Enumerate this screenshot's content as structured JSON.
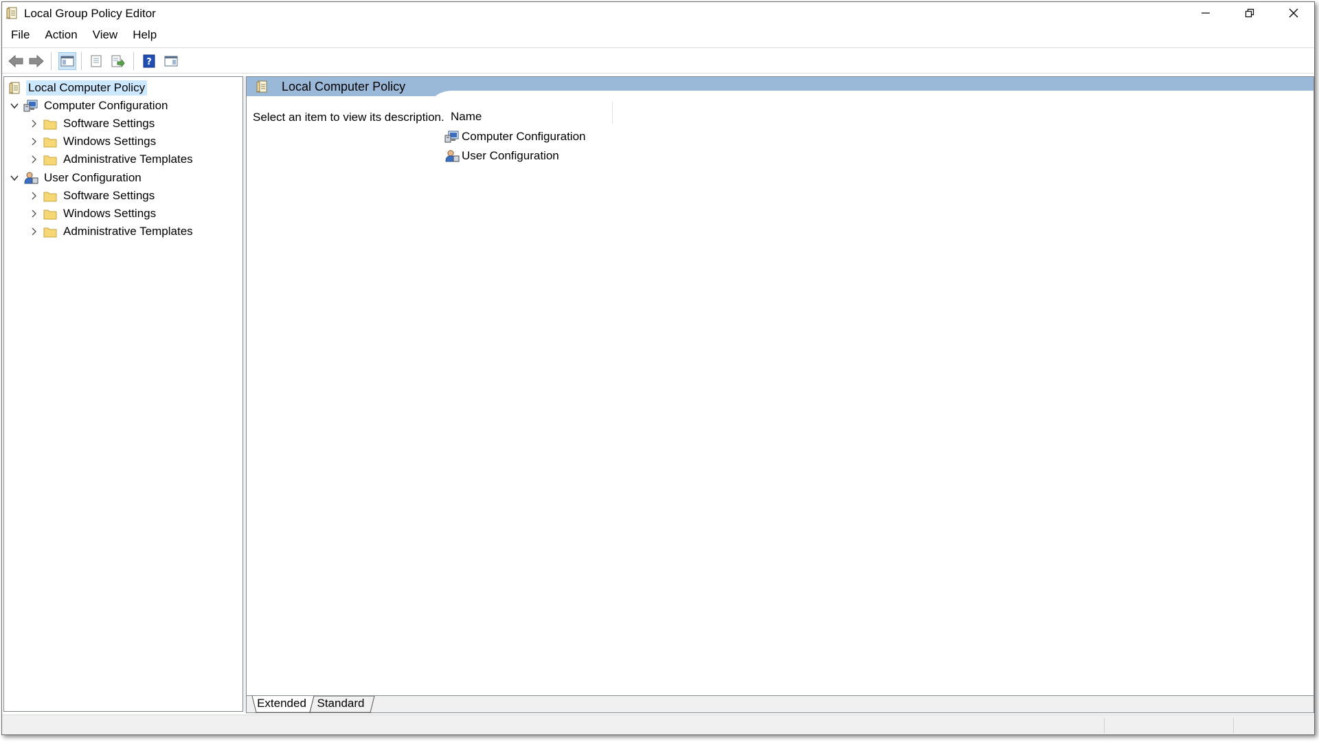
{
  "window": {
    "title": "Local Group Policy Editor",
    "controls": [
      "minimize",
      "restore",
      "close"
    ]
  },
  "menu": {
    "items": [
      "File",
      "Action",
      "View",
      "Help"
    ]
  },
  "toolbar": {
    "buttons": [
      {
        "name": "back",
        "icon": "back-arrow-icon"
      },
      {
        "name": "forward",
        "icon": "forward-arrow-icon"
      },
      {
        "name": "show-hide-console-tree",
        "icon": "console-tree-icon",
        "active": true
      },
      {
        "name": "properties",
        "icon": "properties-icon"
      },
      {
        "name": "export-list",
        "icon": "export-list-icon"
      },
      {
        "name": "help",
        "icon": "help-icon"
      },
      {
        "name": "show-hide-action-pane",
        "icon": "action-pane-icon"
      }
    ]
  },
  "tree": {
    "root": "Local Computer Policy",
    "computer": {
      "label": "Computer Configuration",
      "children": [
        "Software Settings",
        "Windows Settings",
        "Administrative Templates"
      ]
    },
    "user": {
      "label": "User Configuration",
      "children": [
        "Software Settings",
        "Windows Settings",
        "Administrative Templates"
      ]
    }
  },
  "details": {
    "header": "Local Computer Policy",
    "description": "Select an item to view its description.",
    "column_name": "Name",
    "items": [
      "Computer Configuration",
      "User Configuration"
    ]
  },
  "tabs": {
    "extended": "Extended",
    "standard": "Standard",
    "active": "Extended"
  },
  "colors": {
    "header_band": "#9ab9d9",
    "selection": "#cce8ff",
    "folder": "#f7d774"
  }
}
